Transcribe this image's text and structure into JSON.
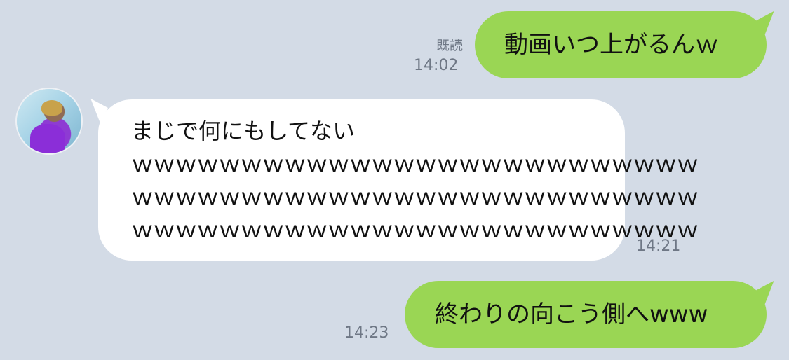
{
  "chat": {
    "messages": [
      {
        "type": "sent",
        "text": "動画いつ上がるんｗ",
        "read_label": "既読",
        "time": "14:02"
      },
      {
        "type": "received",
        "lines": [
          "まじで何にもしてない",
          "ｗｗｗｗｗｗｗｗｗｗｗｗｗｗｗｗｗｗｗｗｗｗｗｗｗｗ",
          "ｗｗｗｗｗｗｗｗｗｗｗｗｗｗｗｗｗｗｗｗｗｗｗｗｗｗ",
          "ｗｗｗｗｗｗｗｗｗｗｗｗｗｗｗｗｗｗｗｗｗｗｗｗｗｗ"
        ],
        "time": "14:21"
      },
      {
        "type": "sent",
        "text": "終わりの向こう側へwww",
        "time": "14:23"
      }
    ]
  },
  "colors": {
    "background": "#d3dbe6",
    "sent_bubble": "#9ad654",
    "received_bubble": "#ffffff",
    "meta_text": "#6e7785"
  },
  "icons": {
    "avatar": "user-avatar"
  }
}
